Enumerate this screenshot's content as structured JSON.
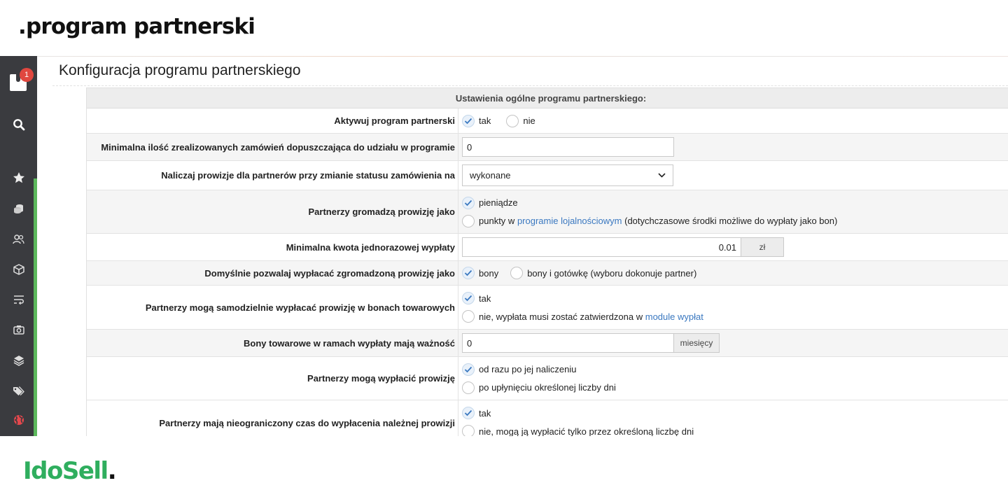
{
  "banner": {
    "title": ".program partnerski"
  },
  "brand": {
    "name": "IdoSell",
    "dot": "."
  },
  "sidebar": {
    "notification_count": "1",
    "items": [
      {
        "icon": "search-icon"
      },
      {
        "icon": "star-icon"
      },
      {
        "icon": "coins-icon"
      },
      {
        "icon": "users-icon"
      },
      {
        "icon": "box-icon"
      },
      {
        "icon": "wrap-text-icon"
      },
      {
        "icon": "camera-icon"
      },
      {
        "icon": "layers-icon"
      },
      {
        "icon": "tags-icon"
      },
      {
        "icon": "globe-icon"
      }
    ],
    "colors": {
      "background": "#3a3b3f",
      "accent": "#5cb85c",
      "badge": "#e0473f"
    }
  },
  "page": {
    "title": "Konfiguracja programu partnerskiego",
    "section_header": "Ustawienia ogólne programu partnerskiego:"
  },
  "rows": {
    "activate": {
      "label": "Aktywuj program partnerski",
      "option_yes": "tak",
      "option_no": "nie",
      "selected": "tak"
    },
    "min_orders": {
      "label": "Minimalna ilość zrealizowanych zamówień dopuszczająca do udziału w programie",
      "value": "0"
    },
    "commission_status": {
      "label": "Naliczaj prowizje dla partnerów przy zmianie statusu zamówienia na",
      "selected": "wykonane"
    },
    "collect_as": {
      "label": "Partnerzy gromadzą prowizję jako",
      "option_money": "pieniądze",
      "option_points_prefix": "punkty w",
      "option_points_link": "programie lojalnościowym",
      "option_points_suffix": "(dotychczasowe środki możliwe do wypłaty jako bon)",
      "selected": "pieniądze"
    },
    "min_payout": {
      "label": "Minimalna kwota jednorazowej wypłaty",
      "value": "0.01",
      "unit": "zł"
    },
    "default_payout": {
      "label": "Domyślnie pozwalaj wypłacać zgromadzoną prowizję jako",
      "option_vouchers": "bony",
      "option_vouchers_cash": "bony i gotówkę (wyboru dokonuje partner)",
      "selected": "bony"
    },
    "self_payout": {
      "label": "Partnerzy mogą samodzielnie wypłacać prowizję w bonach towarowych",
      "option_yes": "tak",
      "option_no_prefix": "nie, wypłata musi zostać zatwierdzona w",
      "option_no_link": "module wypłat",
      "selected": "tak"
    },
    "voucher_validity": {
      "label": "Bony towarowe w ramach wypłaty mają ważność",
      "value": "0",
      "unit": "miesięcy"
    },
    "payout_timing": {
      "label": "Partnerzy mogą wypłacić prowizję",
      "option_immediately": "od razu po jej naliczeniu",
      "option_after_days": "po upłynięciu określonej liczby dni",
      "selected": "od razu po jej naliczeniu"
    },
    "unlimited_time": {
      "label": "Partnerzy mają nieograniczony czas do wypłacenia należnej prowizji",
      "option_yes": "tak",
      "option_no": "nie, mogą ją wypłacić tylko przez określoną liczbę dni",
      "selected": "tak"
    }
  }
}
